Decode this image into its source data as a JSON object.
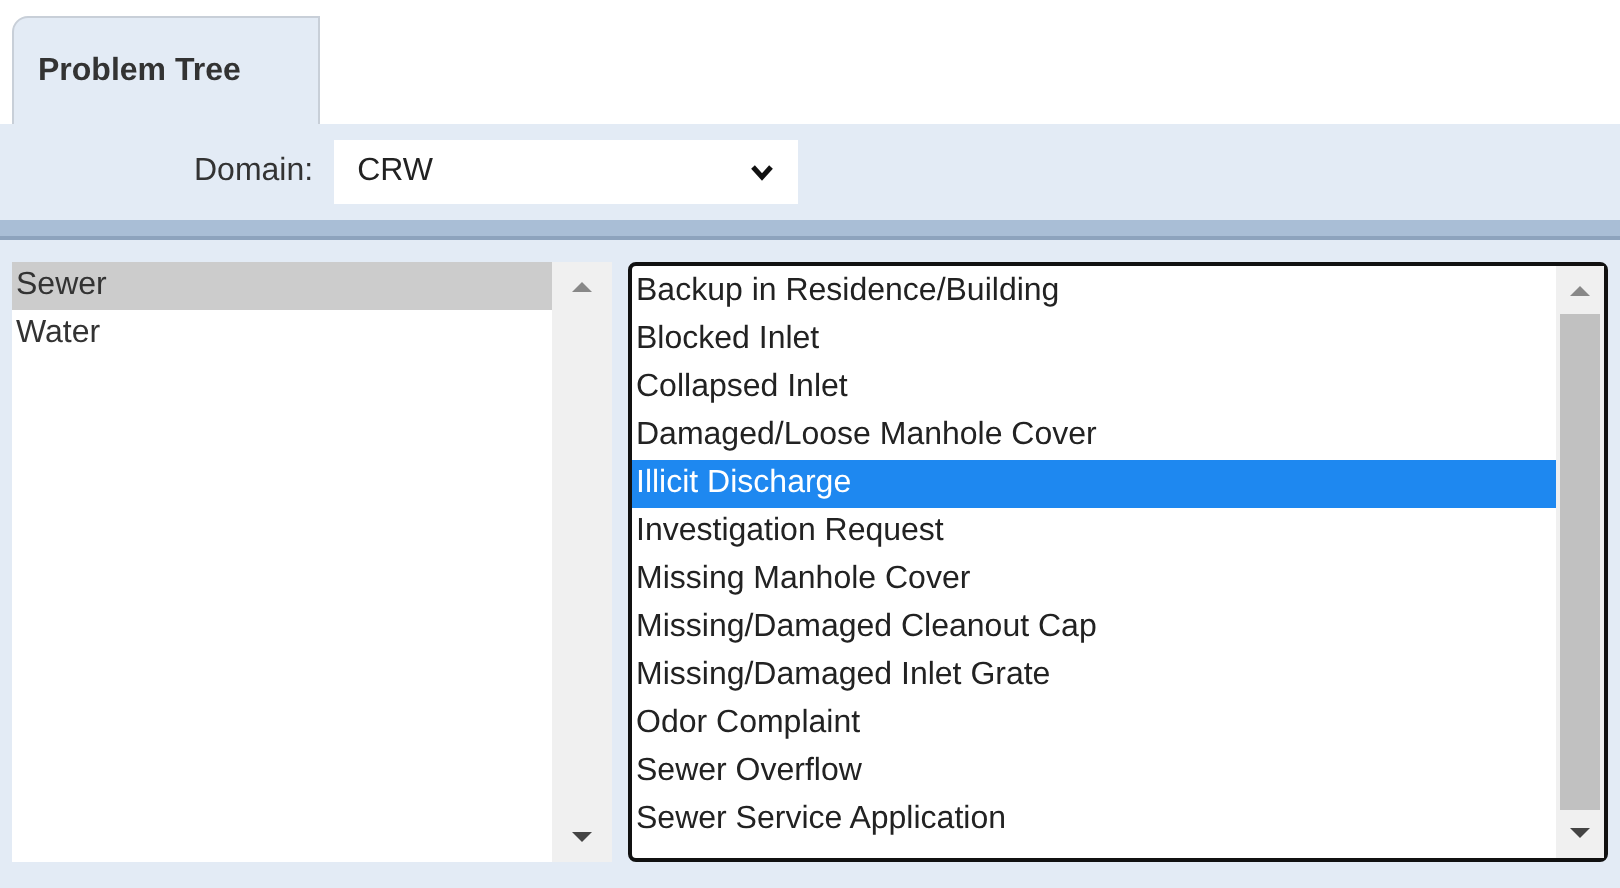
{
  "tabs": [
    {
      "label": "Problem Tree",
      "selected": true
    }
  ],
  "domain": {
    "label": "Domain:",
    "value": "CRW"
  },
  "categories": [
    {
      "label": "Sewer",
      "selected": true
    },
    {
      "label": "Water",
      "selected": false
    }
  ],
  "problems": [
    {
      "label": "Backup in Residence/Building",
      "selected": false
    },
    {
      "label": "Blocked Inlet",
      "selected": false
    },
    {
      "label": "Collapsed Inlet",
      "selected": false
    },
    {
      "label": "Damaged/Loose Manhole Cover",
      "selected": false
    },
    {
      "label": "Illicit Discharge",
      "selected": true
    },
    {
      "label": "Investigation Request",
      "selected": false
    },
    {
      "label": "Missing Manhole Cover",
      "selected": false
    },
    {
      "label": "Missing/Damaged Cleanout Cap",
      "selected": false
    },
    {
      "label": "Missing/Damaged Inlet Grate",
      "selected": false
    },
    {
      "label": "Odor Complaint",
      "selected": false
    },
    {
      "label": "Sewer Overflow",
      "selected": false
    },
    {
      "label": "Sewer Service Application",
      "selected": false
    }
  ]
}
